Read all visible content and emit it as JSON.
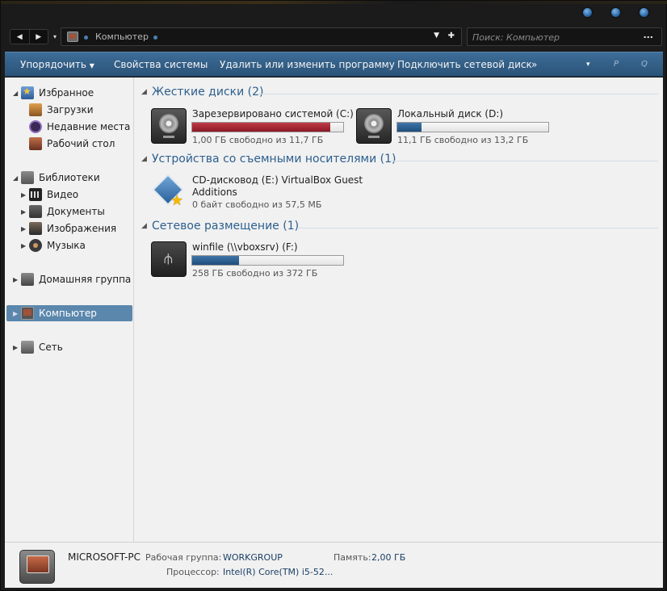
{
  "window": {
    "caption_buttons": [
      "minimize-icon",
      "maximize-icon",
      "close-icon"
    ]
  },
  "address": {
    "path_label": "Компьютер",
    "search_placeholder": "Поиск: Компьютер"
  },
  "toolbar": {
    "organize": "Упорядочить",
    "system_properties": "Свойства системы",
    "uninstall": "Удалить или изменить программу",
    "map_drive": "Подключить сетевой диск",
    "more": "»",
    "view": "▾",
    "pane": "P",
    "help": "Q"
  },
  "sidebar": {
    "favorites": "Избранное",
    "downloads": "Загрузки",
    "recent": "Недавние места",
    "desktop": "Рабочий стол",
    "libraries": "Библиотеки",
    "video": "Видео",
    "documents": "Документы",
    "images": "Изображения",
    "music": "Музыка",
    "homegroup": "Домашняя группа",
    "computer": "Компьютер",
    "network": "Сеть"
  },
  "sections": {
    "hard_disks": "Жесткие диски (2)",
    "removable": "Устройства со съемными носителями (1)",
    "network": "Сетевое размещение (1)"
  },
  "drives": [
    {
      "name": "Зарезервировано системой (C:)",
      "free": "1,00 ГБ свободно из 11,7 ГБ",
      "used_fraction": 0.915,
      "color": "#9e2030"
    },
    {
      "name": "Локальный диск (D:)",
      "free": "11,1 ГБ свободно из 13,2 ГБ",
      "used_fraction": 0.16,
      "color": "#2d5f92"
    }
  ],
  "cd": {
    "name_line1": "CD-дисковод (E:) VirtualBox Guest",
    "name_line2": "Additions",
    "free": "0 байт свободно из 57,5 МБ"
  },
  "netdrive": {
    "name": "winfile (\\\\vboxsrv) (F:)",
    "free": "258 ГБ свободно из 372 ГБ",
    "used_fraction": 0.31,
    "color": "#2d5f92"
  },
  "details": {
    "computer_name": "MICROSOFT-PC",
    "workgroup_label": "Рабочая группа:",
    "workgroup_value": "WORKGROUP",
    "memory_label": "Память:",
    "memory_value": "2,00 ГБ",
    "cpu_label": "Процессор:",
    "cpu_value": "Intel(R) Core(TM) i5-52..."
  }
}
